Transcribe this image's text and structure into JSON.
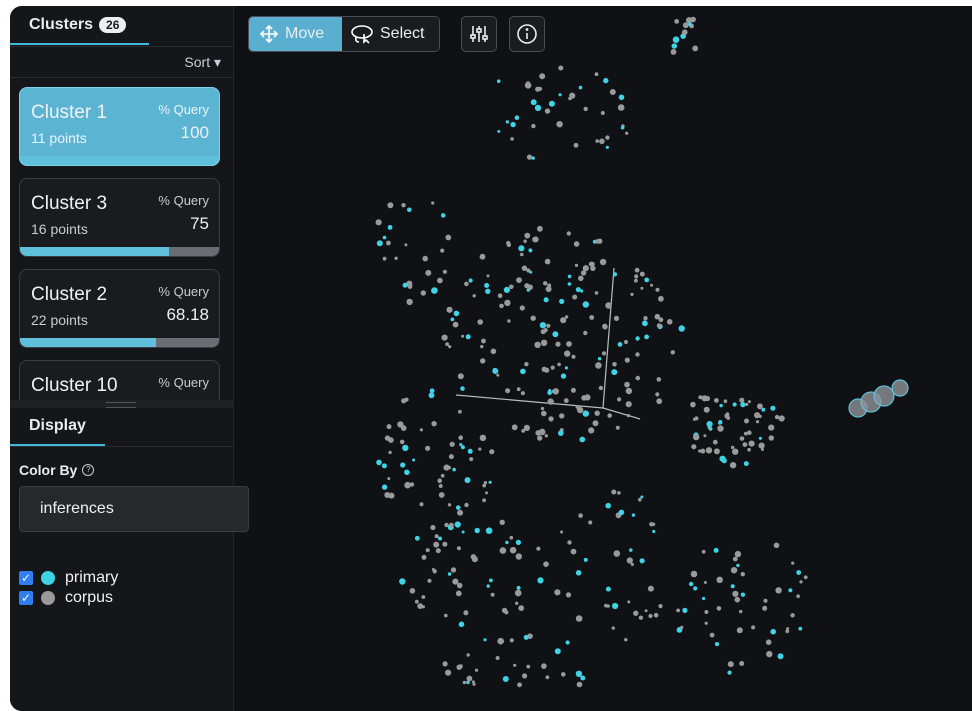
{
  "sidebar": {
    "clusters_title": "Clusters",
    "clusters_count": "26",
    "sort_label": "Sort ▾",
    "clusters": [
      {
        "name": "Cluster 1",
        "points": "11 points",
        "query_label": "% Query",
        "query_value": "100",
        "query_fraction": 1.0,
        "active": true
      },
      {
        "name": "Cluster 3",
        "points": "16 points",
        "query_label": "% Query",
        "query_value": "75",
        "query_fraction": 0.75,
        "active": false
      },
      {
        "name": "Cluster 2",
        "points": "22 points",
        "query_label": "% Query",
        "query_value": "68.18",
        "query_fraction": 0.6818,
        "active": false
      },
      {
        "name": "Cluster 10",
        "points": "",
        "query_label": "% Query",
        "query_value": "",
        "query_fraction": null,
        "active": false
      }
    ],
    "display_title": "Display",
    "color_by_label": "Color By",
    "color_by_value": "inferences",
    "legend": [
      {
        "label": "primary",
        "color": "#3fd3e6",
        "checked": true
      },
      {
        "label": "corpus",
        "color": "#9a9a9a",
        "checked": true
      }
    ]
  },
  "toolbar": {
    "move_label": "Move",
    "select_label": "Select",
    "active_mode": "move"
  },
  "colors": {
    "accent": "#5aaed0",
    "background": "#0f1115",
    "primary_point": "#3fd3e6",
    "corpus_point": "#9a9a9a"
  }
}
